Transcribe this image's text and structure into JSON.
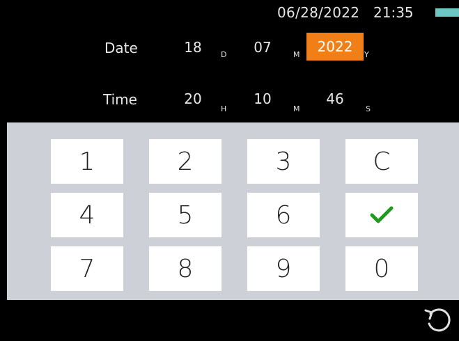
{
  "status": {
    "date": "06/28/2022",
    "time": "21:35",
    "battery_color": "#6cc6c2"
  },
  "date_row": {
    "label": "Date",
    "fields": [
      {
        "value": "18",
        "unit": "D"
      },
      {
        "value": "07",
        "unit": "M"
      },
      {
        "value": "2022",
        "unit": "Y",
        "active": true
      }
    ]
  },
  "time_row": {
    "label": "Time",
    "fields": [
      {
        "value": "20",
        "unit": "H"
      },
      {
        "value": "10",
        "unit": "M"
      },
      {
        "value": "46",
        "unit": "S"
      }
    ]
  },
  "keypad": {
    "keys": [
      [
        "1",
        "2",
        "3",
        "C"
      ],
      [
        "4",
        "5",
        "6",
        "check-icon"
      ],
      [
        "7",
        "8",
        "9",
        "0"
      ]
    ],
    "confirm_color": "#1f9a1f"
  },
  "nav": {
    "back_icon": "rotate-back-icon"
  },
  "colors": {
    "active_field": "#f07f17",
    "panel": "#cdd1d7"
  }
}
